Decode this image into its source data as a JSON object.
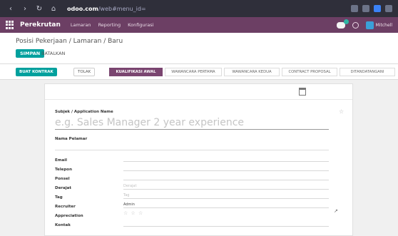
{
  "browser": {
    "url_prefix": "Odoo.com/web#",
    "url_bold": "odoo.com",
    "url_rest": "/web#menu_id="
  },
  "nav": {
    "app_name": "Perekrutan",
    "menu": [
      "Lamaran",
      "Reporting",
      "Konfigurasi"
    ],
    "user_label": "Mitchell"
  },
  "control": {
    "breadcrumb": "Posisi Pekerjaan / Lamaran / Baru",
    "save": "SIMPAN",
    "discard": "BATALKAN"
  },
  "status": {
    "create_contract": "BUAT KONTRAK",
    "refuse": "TOLAK",
    "stages": [
      "KUALIFIKASI AWAL",
      "WAWANCARA PERTAMA",
      "WAWANCARA KEDUA",
      "CONTRACT PROPOSAL",
      "DITANDATANGANI"
    ],
    "active_stage_index": 0
  },
  "form": {
    "subject_label": "Subjek / Application Name",
    "subject_placeholder": "e.g. Sales Manager 2 year experience",
    "applicant_label": "Nama Pelamar",
    "fields": [
      {
        "label": "Email",
        "value": ""
      },
      {
        "label": "Telepon",
        "value": ""
      },
      {
        "label": "Ponsel",
        "value": ""
      },
      {
        "label": "Derajat",
        "value": "Derajat"
      },
      {
        "label": "Tag",
        "value": "Tag"
      },
      {
        "label": "Recruiter",
        "value": "Admin"
      },
      {
        "label": "Appreciation",
        "value": ""
      },
      {
        "label": "Kontak",
        "value": ""
      }
    ],
    "appreciation_stars": "☆ ☆ ☆"
  },
  "icons": {
    "apps": "apps-grid-icon",
    "chat": "chat-icon",
    "clock": "clock-icon",
    "calendar": "calendar-icon",
    "star": "star-icon",
    "external": "external-link-icon"
  },
  "colors": {
    "brand": "#6c3f64",
    "primary": "#00a09d",
    "active_stage": "#7a4570"
  }
}
